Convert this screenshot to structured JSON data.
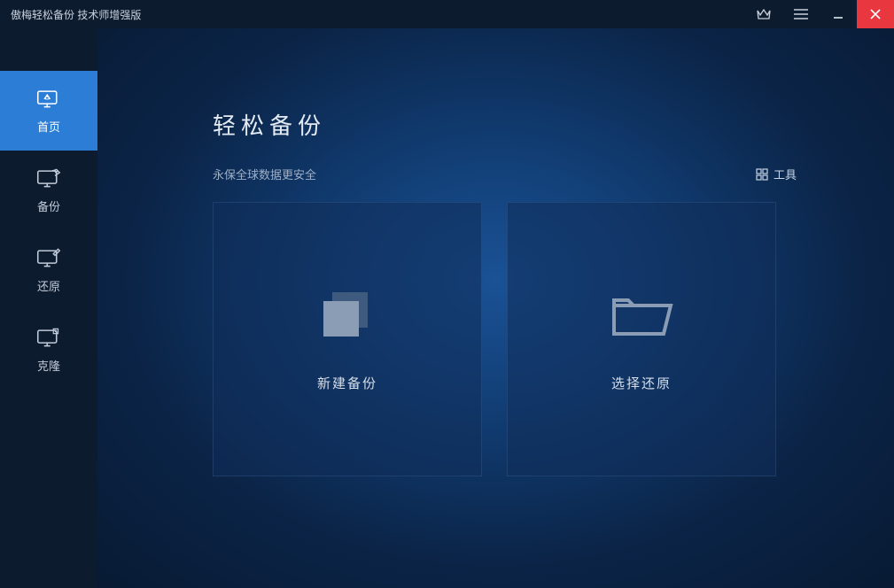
{
  "title": "傲梅轻松备份 技术师增强版",
  "sidebar": {
    "items": [
      {
        "label": "首页"
      },
      {
        "label": "备份"
      },
      {
        "label": "还原"
      },
      {
        "label": "克隆"
      }
    ]
  },
  "main": {
    "heading": "轻松备份",
    "subheading": "永保全球数据更安全",
    "tools_label": "工具"
  },
  "cards": {
    "new_backup": "新建备份",
    "select_restore": "选择还原"
  }
}
